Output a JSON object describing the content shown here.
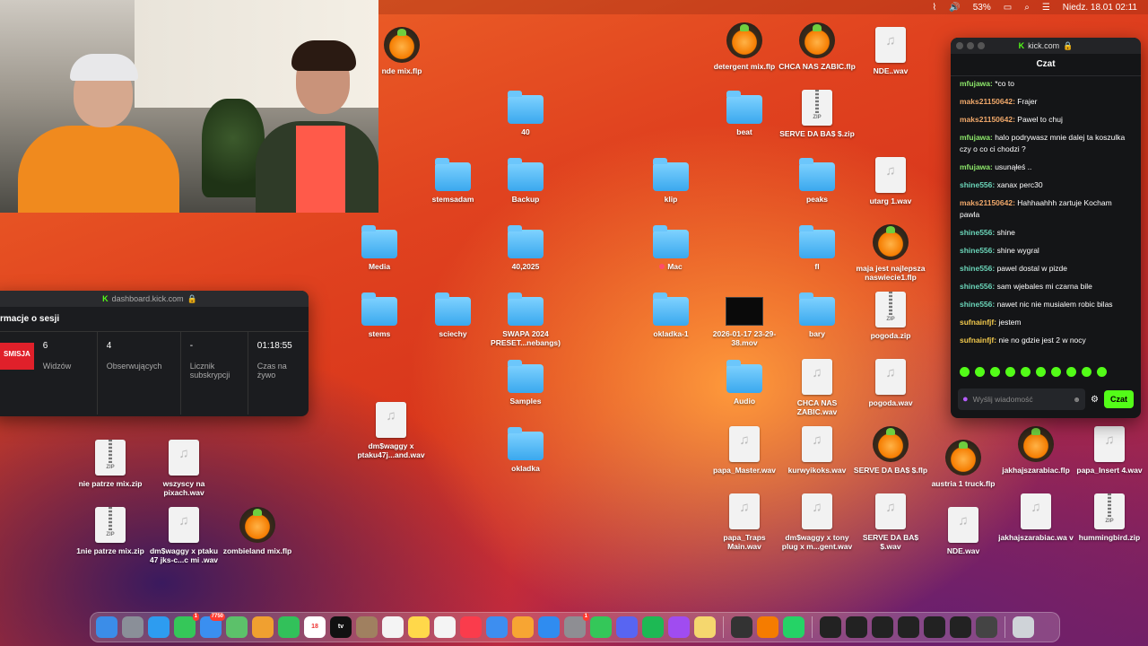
{
  "menubar": {
    "battery": "53%",
    "datetime": "Niedz. 18.01  02:11"
  },
  "desktop_icons": [
    {
      "label": "nde mix.flp",
      "type": "fl"
    },
    {
      "label": "40",
      "type": "folder"
    },
    {
      "label": "stemsadam",
      "type": "folder"
    },
    {
      "label": "Backup",
      "type": "folder"
    },
    {
      "label": "Media",
      "type": "folder"
    },
    {
      "label": "40,2025",
      "type": "folder"
    },
    {
      "label": "stems",
      "type": "folder"
    },
    {
      "label": "sciechy",
      "type": "folder"
    },
    {
      "label": "SWAPA 2024 PRESET...nebangs)",
      "type": "folder"
    },
    {
      "label": "Samples",
      "type": "folder"
    },
    {
      "label": "okladka",
      "type": "folder"
    },
    {
      "label": "dm$waggy x ptaku47j...and.wav",
      "type": "file"
    },
    {
      "label": "nie patrze mix.zip",
      "type": "zip"
    },
    {
      "label": "wszyscy na pixach.wav",
      "type": "file"
    },
    {
      "label": "1nie patrze mix.zip",
      "type": "zip"
    },
    {
      "label": "dm$waggy x ptaku 47 jks-c...c mi .wav",
      "type": "file"
    },
    {
      "label": "zombieland mix.flp",
      "type": "fl"
    },
    {
      "label": "klip",
      "type": "folder"
    },
    {
      "label": "Mac",
      "type": "folder",
      "tag": true
    },
    {
      "label": "okladka-1",
      "type": "folder"
    },
    {
      "label": "detergent mix.flp",
      "type": "fl"
    },
    {
      "label": "beat",
      "type": "folder"
    },
    {
      "label": "2026-01-17 23-29-38.mov",
      "type": "video"
    },
    {
      "label": "Audio",
      "type": "folder"
    },
    {
      "label": "papa_Master.wav",
      "type": "file"
    },
    {
      "label": "papa_Traps Main.wav",
      "type": "file"
    },
    {
      "label": "CHCA NAS ZABIC.flp",
      "type": "fl"
    },
    {
      "label": "SERVE DA BA$ $.zip",
      "type": "zip"
    },
    {
      "label": "peaks",
      "type": "folder"
    },
    {
      "label": "fl",
      "type": "folder"
    },
    {
      "label": "bary",
      "type": "folder"
    },
    {
      "label": "CHCA NAS ZABIC.wav",
      "type": "file"
    },
    {
      "label": "kurwyikoks.wav",
      "type": "file"
    },
    {
      "label": "dm$waggy x tony plug x m...gent.wav",
      "type": "file"
    },
    {
      "label": "NDE..wav",
      "type": "file"
    },
    {
      "label": "utarg 1.wav",
      "type": "file"
    },
    {
      "label": "maja jest najlepsza naswiecie1.flp",
      "type": "fl"
    },
    {
      "label": "pogoda.zip",
      "type": "zip"
    },
    {
      "label": "pogoda.wav",
      "type": "file"
    },
    {
      "label": "SERVE DA BA$ $.flp",
      "type": "fl"
    },
    {
      "label": "SERVE DA BA$ $.wav",
      "type": "file"
    },
    {
      "label": "austria 1 truck.flp",
      "type": "fl"
    },
    {
      "label": "NDE.wav",
      "type": "file"
    },
    {
      "label": "jakhajszarabiac.flp",
      "type": "fl"
    },
    {
      "label": "jakhajszarabiac.wa v",
      "type": "file"
    },
    {
      "label": "papa_Insert 4.wav",
      "type": "file"
    },
    {
      "label": "hummingbird.zip",
      "type": "zip"
    }
  ],
  "dashboard": {
    "url": "dashboard.kick.com",
    "section_title": "rmacje o sesji",
    "live_badge": "SMISJA",
    "stats": [
      {
        "value": "6",
        "label": "Widzów"
      },
      {
        "value": "4",
        "label": "Obserwujących"
      },
      {
        "value": "-",
        "label": "Licznik subskrypcji"
      },
      {
        "value": "01:18:55",
        "label": "Czas na żywo"
      }
    ]
  },
  "chat": {
    "url": "kick.com",
    "header": "Czat",
    "messages": [
      {
        "user": "mfujawa",
        "color": "#8de86a",
        "text": "*co to"
      },
      {
        "user": "maks21150642",
        "color": "#f0a86a",
        "text": "Frajer"
      },
      {
        "user": "maks21150642",
        "color": "#f0a86a",
        "text": "Pawel to chuj"
      },
      {
        "user": "mfujawa",
        "color": "#8de86a",
        "text": "halo podrywasz mnie dalej ta koszulka czy o co ci chodzi ?"
      },
      {
        "user": "mfujawa",
        "color": "#8de86a",
        "text": "usunąłeś .."
      },
      {
        "user": "shine556",
        "color": "#6ad4b8",
        "text": "xanax perc30"
      },
      {
        "user": "maks21150642",
        "color": "#f0a86a",
        "text": "Hahhaahhh zartuje Kocham pawla"
      },
      {
        "user": "shine556",
        "color": "#6ad4b8",
        "text": "shine"
      },
      {
        "user": "shine556",
        "color": "#6ad4b8",
        "text": "shine wygral"
      },
      {
        "user": "shine556",
        "color": "#6ad4b8",
        "text": "pawel dostal w pizde"
      },
      {
        "user": "shine556",
        "color": "#6ad4b8",
        "text": "sam wjebales mi czarna bile"
      },
      {
        "user": "shine556",
        "color": "#6ad4b8",
        "text": "nawet nic nie musialem robic bilas"
      },
      {
        "user": "sufnainfjf",
        "color": "#f2c94c",
        "text": "jestem"
      },
      {
        "user": "sufnainfjf",
        "color": "#f2c94c",
        "text": "nie no gdzie jest 2 w nocy"
      }
    ],
    "input_placeholder": "Wyślij wiadomość",
    "send_label": "Czat"
  },
  "dock": {
    "apps": [
      {
        "name": "finder",
        "color": "#3b8de8"
      },
      {
        "name": "launchpad",
        "color": "#8a8f98"
      },
      {
        "name": "safari",
        "color": "#2d9cf0"
      },
      {
        "name": "messages",
        "color": "#35c759",
        "badge": "1"
      },
      {
        "name": "mail",
        "color": "#3a8ff0",
        "badge": "7750"
      },
      {
        "name": "maps",
        "color": "#5cc16a"
      },
      {
        "name": "photos",
        "color": "#f0a030"
      },
      {
        "name": "facetime",
        "color": "#32c15a"
      },
      {
        "name": "calendar",
        "color": "#ffffff",
        "text": "18"
      },
      {
        "name": "apple-tv",
        "color": "#111111",
        "text": "tv"
      },
      {
        "name": "finder-2",
        "color": "#a08060"
      },
      {
        "name": "reminders",
        "color": "#f4f4f4"
      },
      {
        "name": "notes",
        "color": "#ffd84a"
      },
      {
        "name": "freeform",
        "color": "#f4f4f4"
      },
      {
        "name": "music",
        "color": "#fa3c4c"
      },
      {
        "name": "keynote",
        "color": "#3d8ef0"
      },
      {
        "name": "pages",
        "color": "#f7a533"
      },
      {
        "name": "app-store",
        "color": "#2f8cf0"
      },
      {
        "name": "system-settings",
        "color": "#8e8e93",
        "badge": "1"
      },
      {
        "name": "numbers",
        "color": "#34c759"
      },
      {
        "name": "discord",
        "color": "#5865f2"
      },
      {
        "name": "spotify",
        "color": "#1db954"
      },
      {
        "name": "messenger",
        "color": "#a04cf0"
      },
      {
        "name": "stickies",
        "color": "#f5d76e"
      },
      {
        "name": "activity-monitor",
        "color": "#333333"
      },
      {
        "name": "fl-studio",
        "color": "#f57c00"
      },
      {
        "name": "whatsapp",
        "color": "#25d366"
      },
      {
        "name": "window-1",
        "color": "#222222"
      },
      {
        "name": "window-2",
        "color": "#222222"
      },
      {
        "name": "window-3",
        "color": "#222222"
      },
      {
        "name": "window-4",
        "color": "#222222"
      },
      {
        "name": "window-5",
        "color": "#222222"
      },
      {
        "name": "window-6",
        "color": "#222222"
      },
      {
        "name": "window-7",
        "color": "#444444"
      },
      {
        "name": "trash",
        "color": "#cfd3d8"
      }
    ]
  }
}
